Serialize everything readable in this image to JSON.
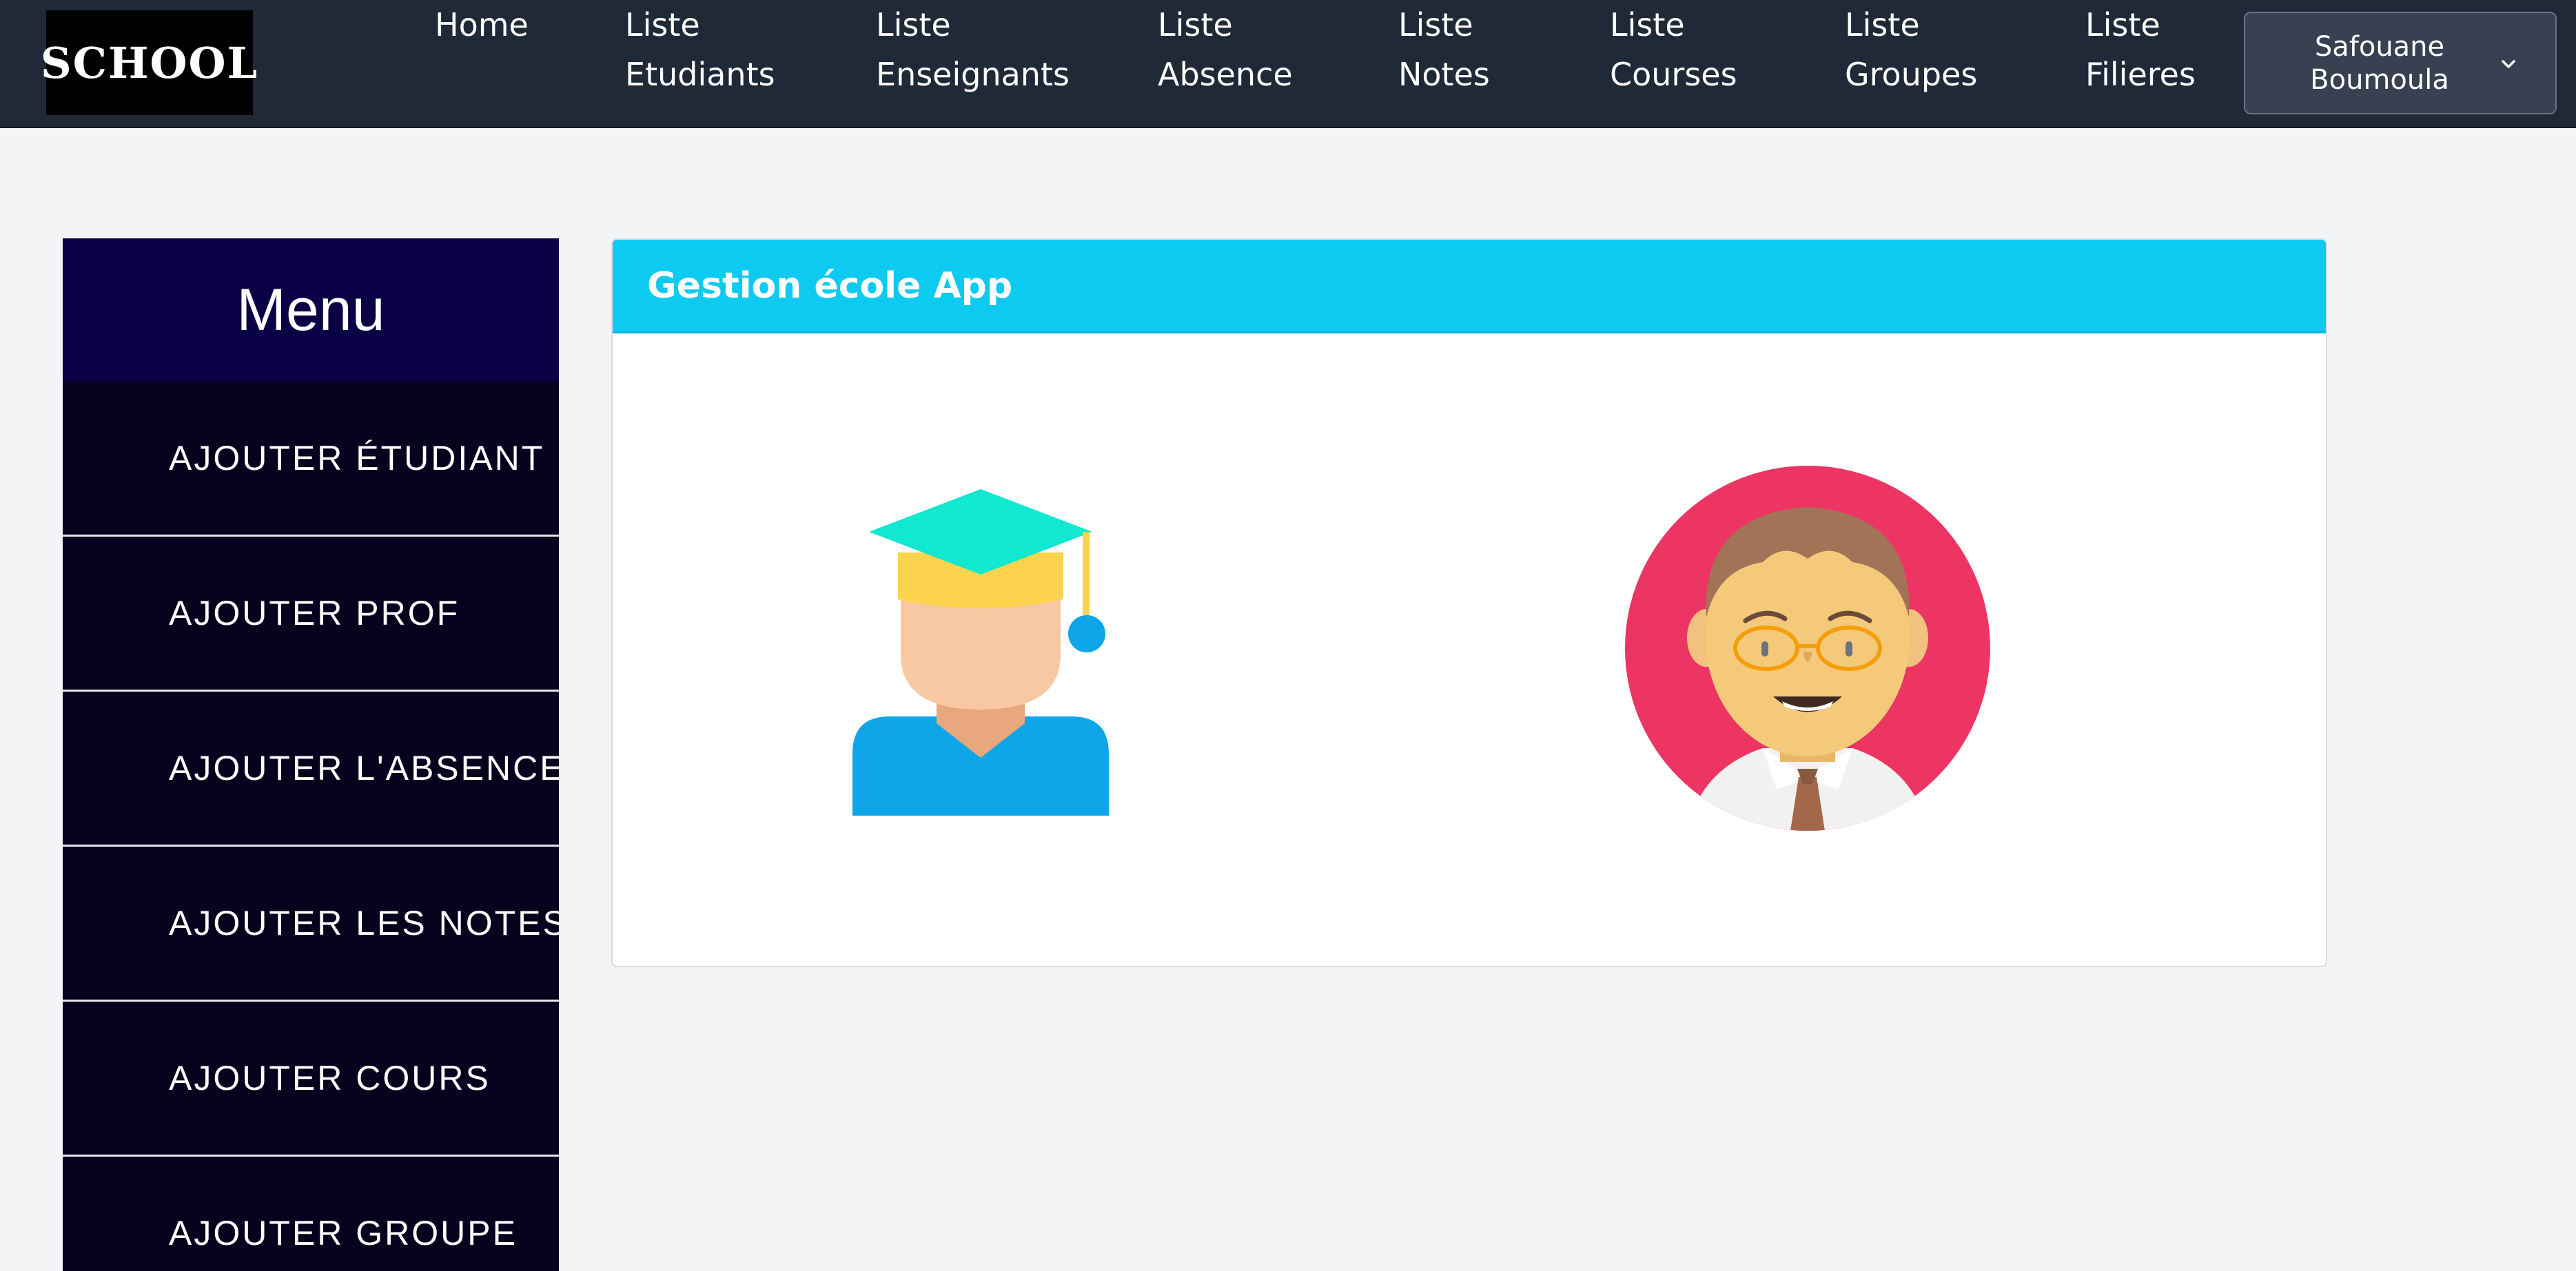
{
  "logo": {
    "text": "SCHOOL"
  },
  "nav": {
    "home": "Home",
    "links": [
      {
        "line1": "Liste",
        "line2": "Etudiants"
      },
      {
        "line1": "Liste",
        "line2": "Enseignants"
      },
      {
        "line1": "Liste",
        "line2": "Absence"
      },
      {
        "line1": "Liste",
        "line2": "Notes"
      },
      {
        "line1": "Liste",
        "line2": "Courses"
      },
      {
        "line1": "Liste",
        "line2": "Groupes"
      },
      {
        "line1": "Liste",
        "line2": "Filieres"
      }
    ],
    "user": {
      "first": "Safouane",
      "last": "Boumoula",
      "icon": "chevron-down-icon"
    }
  },
  "sidebar": {
    "title": "Menu",
    "items": [
      {
        "label": "AJOUTER ÉTUDIANT"
      },
      {
        "label": "AJOUTER PROF"
      },
      {
        "label": "AJOUTER L'ABSENCE"
      },
      {
        "label": "AJOUTER LES NOTES"
      },
      {
        "label": "AJOUTER COURS"
      },
      {
        "label": "AJOUTER GROUPE"
      }
    ]
  },
  "main": {
    "card_title": "Gestion école App",
    "illustrations": [
      "student-graduate-illustration",
      "teacher-avatar-illustration"
    ]
  },
  "colors": {
    "topbar": "#1f2937",
    "sidebar": "#06021e",
    "sidebar_title": "#0a0046",
    "card_header": "#0dcaf0",
    "page_bg": "#f3f4f6"
  }
}
